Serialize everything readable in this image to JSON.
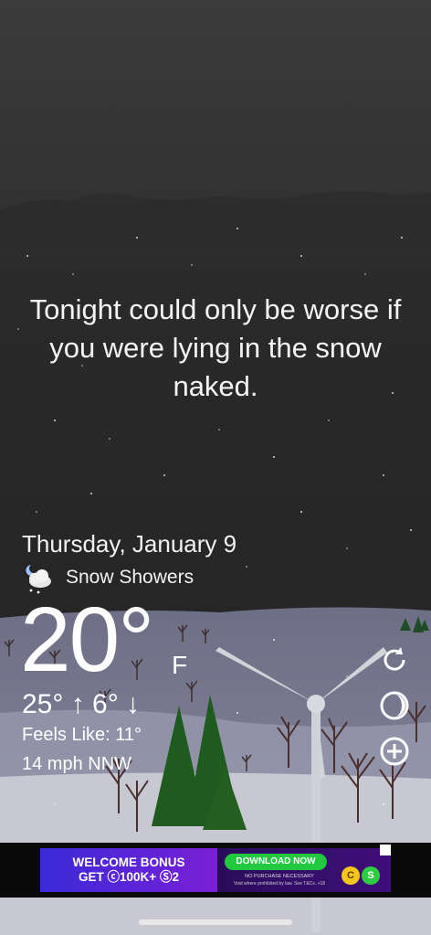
{
  "headline": "Tonight could only be worse if you were lying in the snow naked.",
  "weather": {
    "date": "Thursday, January 9",
    "condition": "Snow Showers",
    "condition_icon": "night-snow-cloud-icon",
    "temperature": "20°",
    "unit": "F",
    "high_low": "25° ↑ 6° ↓",
    "feels_like": "Feels Like: 11°",
    "wind": "14 mph NNW"
  },
  "actions": {
    "refresh_icon": "refresh-icon",
    "moon_icon": "moon-phase-icon",
    "add_icon": "add-circle-icon"
  },
  "ad": {
    "left_line1": "WELCOME BONUS",
    "left_line2": "GET ⓒ100K+ Ⓢ2",
    "download_label": "DOWNLOAD NOW",
    "small1": "NO PURCHASE NECESSARY",
    "small2": "Void where prohibited by law. See T&Cs. +18",
    "coin_c": "C",
    "coin_s": "S"
  },
  "colors": {
    "sky_top": "#3a3a3a",
    "sky_night": "#232323",
    "snow_field": "#c9ccd3",
    "tree_green": "#1f5a1f"
  }
}
